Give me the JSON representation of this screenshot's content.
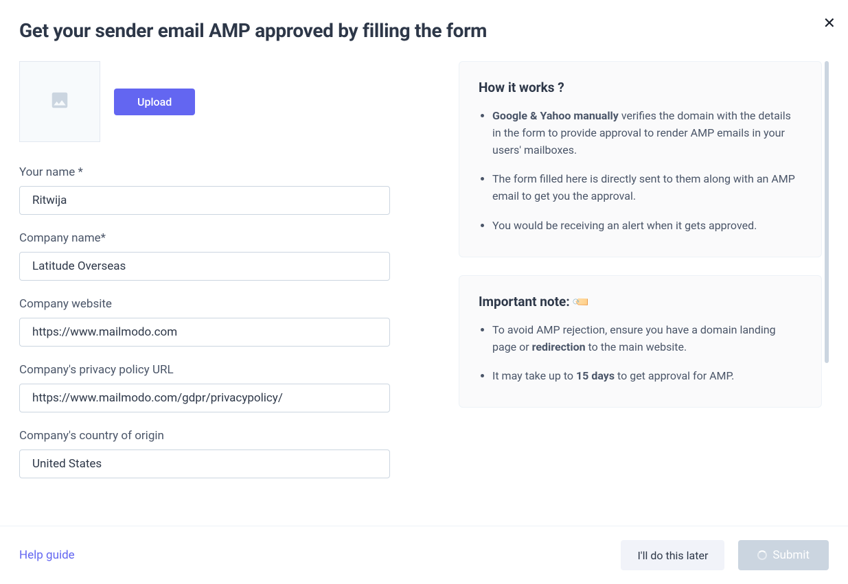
{
  "title": "Get your sender email AMP approved by filling the form",
  "upload_button": "Upload",
  "fields": {
    "name": {
      "label": "Your name *",
      "value": "Ritwija"
    },
    "company": {
      "label": "Company name*",
      "value": "Latitude Overseas"
    },
    "website": {
      "label": "Company website",
      "value": "https://www.mailmodo.com"
    },
    "privacy": {
      "label": "Company's privacy policy URL",
      "value": "https://www.mailmodo.com/gdpr/privacypolicy/"
    },
    "country": {
      "label": "Company's country of origin",
      "value": "United States"
    }
  },
  "how_it_works": {
    "title": "How it works ?",
    "items": [
      {
        "bold": "Google & Yahoo manually",
        "rest": " verifies the domain with the details in the form to provide approval to render AMP emails in your users' mailboxes."
      },
      {
        "bold": "",
        "rest": "The form filled here is directly sent to them along with an AMP email to get you the approval."
      },
      {
        "bold": "",
        "rest": "You would be receiving an alert when it gets approved."
      }
    ]
  },
  "important_note": {
    "title": "Important note:",
    "items": [
      {
        "pre": "To avoid AMP rejection, ensure you have a domain landing page or ",
        "bold": "redirection",
        "post": " to the main website."
      },
      {
        "pre": "It may take up to ",
        "bold": "15 days",
        "post": " to get approval for AMP."
      }
    ]
  },
  "footer": {
    "help": "Help guide",
    "later": "I'll do this later",
    "submit": "Submit"
  }
}
